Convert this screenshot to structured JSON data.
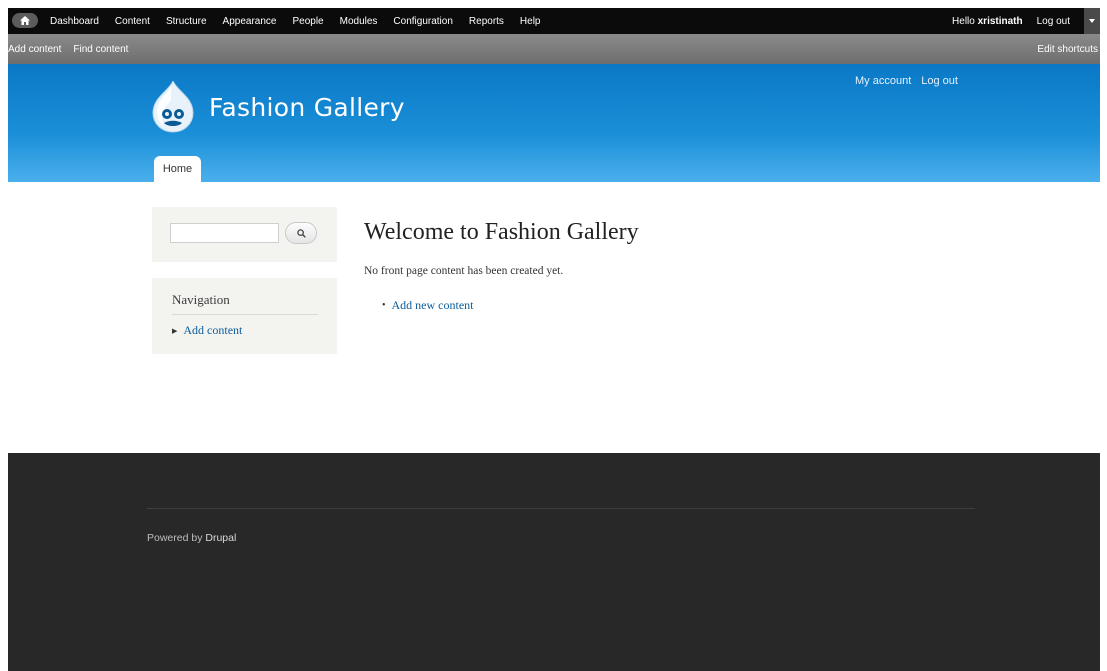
{
  "toolbar": {
    "menu": [
      "Dashboard",
      "Content",
      "Structure",
      "Appearance",
      "People",
      "Modules",
      "Configuration",
      "Reports",
      "Help"
    ],
    "hello_prefix": "Hello",
    "username": "xristinath",
    "logout": "Log out"
  },
  "shortcuts": {
    "add_content": "Add content",
    "find_content": "Find content",
    "edit_shortcuts": "Edit shortcuts"
  },
  "header": {
    "site_name": "Fashion Gallery",
    "secondary_menu": [
      "My account",
      "Log out"
    ],
    "primary_tab": "Home"
  },
  "sidebar": {
    "search_placeholder": "",
    "navigation_title": "Navigation",
    "navigation_items": [
      "Add content"
    ]
  },
  "main": {
    "title": "Welcome to Fashion Gallery",
    "message": "No front page content has been created yet.",
    "link": "Add new content"
  },
  "footer": {
    "powered_prefix": "Powered by",
    "powered_link": "Drupal"
  },
  "colors": {
    "header_blue": "#1b8fd8",
    "link_blue": "#0b5d9b",
    "footer_bg": "#282828"
  }
}
